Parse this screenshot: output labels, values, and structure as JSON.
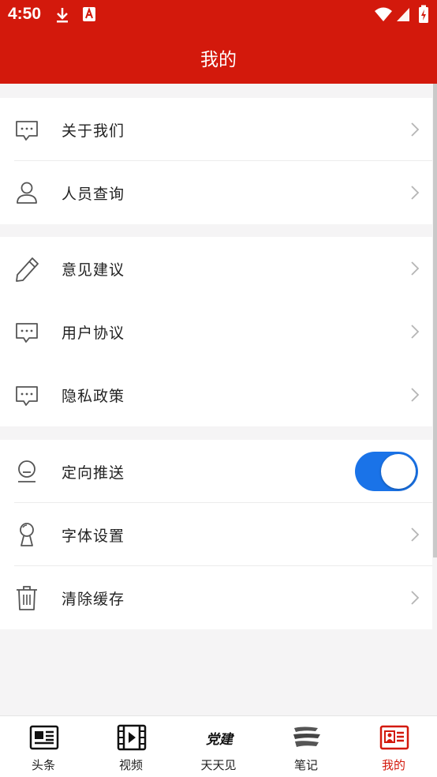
{
  "status_bar": {
    "time": "4:50"
  },
  "header": {
    "title": "我的"
  },
  "groups": [
    {
      "items": [
        {
          "label": "关于我们",
          "icon": "chat-icon"
        },
        {
          "label": "人员查询",
          "icon": "person-icon"
        }
      ]
    },
    {
      "items": [
        {
          "label": "意见建议",
          "icon": "pencil-icon"
        },
        {
          "label": "用户协议",
          "icon": "chat-icon"
        },
        {
          "label": "隐私政策",
          "icon": "chat-icon"
        }
      ]
    },
    {
      "items": [
        {
          "label": "定向推送",
          "icon": "push-icon",
          "toggle": true
        },
        {
          "label": "字体设置",
          "icon": "font-icon"
        },
        {
          "label": "清除缓存",
          "icon": "trash-icon"
        }
      ]
    }
  ],
  "tabs": [
    {
      "label": "头条",
      "icon": "newspaper-icon"
    },
    {
      "label": "视频",
      "icon": "film-icon"
    },
    {
      "label": "天天见",
      "icon": "calligraphy-icon",
      "icon_text": "党建"
    },
    {
      "label": "笔记",
      "icon": "brush-icon"
    },
    {
      "label": "我的",
      "icon": "profile-card-icon",
      "active": true
    }
  ],
  "colors": {
    "brand": "#d3190c",
    "toggle_on": "#1a73e8",
    "background": "#f5f4f5"
  }
}
